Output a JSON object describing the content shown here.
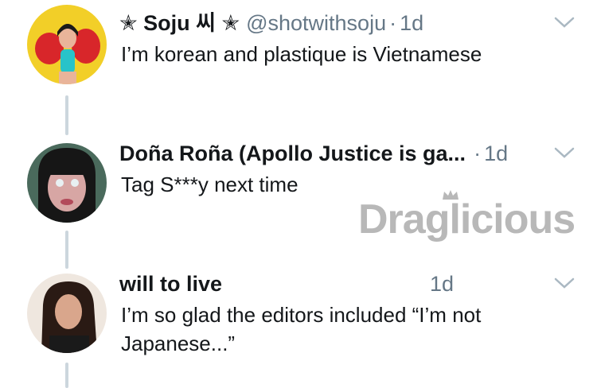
{
  "tweets": [
    {
      "name": "✭ Soju 씨 ✭",
      "handle": "@shotwithsoju",
      "separator": "·",
      "time": "1d",
      "text": "I’m korean and plastique is Vietnamese"
    },
    {
      "name": "Doña Roña (Apollo Justice is ga...",
      "separator": "·",
      "time": "1d",
      "text": "Tag S***y next time"
    },
    {
      "name": "will to live",
      "time": "1d",
      "text_line1": "I’m so glad the editors included “I’m not",
      "text_line2": "Japanese...”"
    }
  ],
  "watermark": "Draglicious",
  "colors": {
    "text": "#14171a",
    "secondary": "#657786",
    "thread_line": "#ccd6dd",
    "caret": "#aab8c2"
  },
  "icons": [
    "chevron-down-icon",
    "avatar"
  ]
}
